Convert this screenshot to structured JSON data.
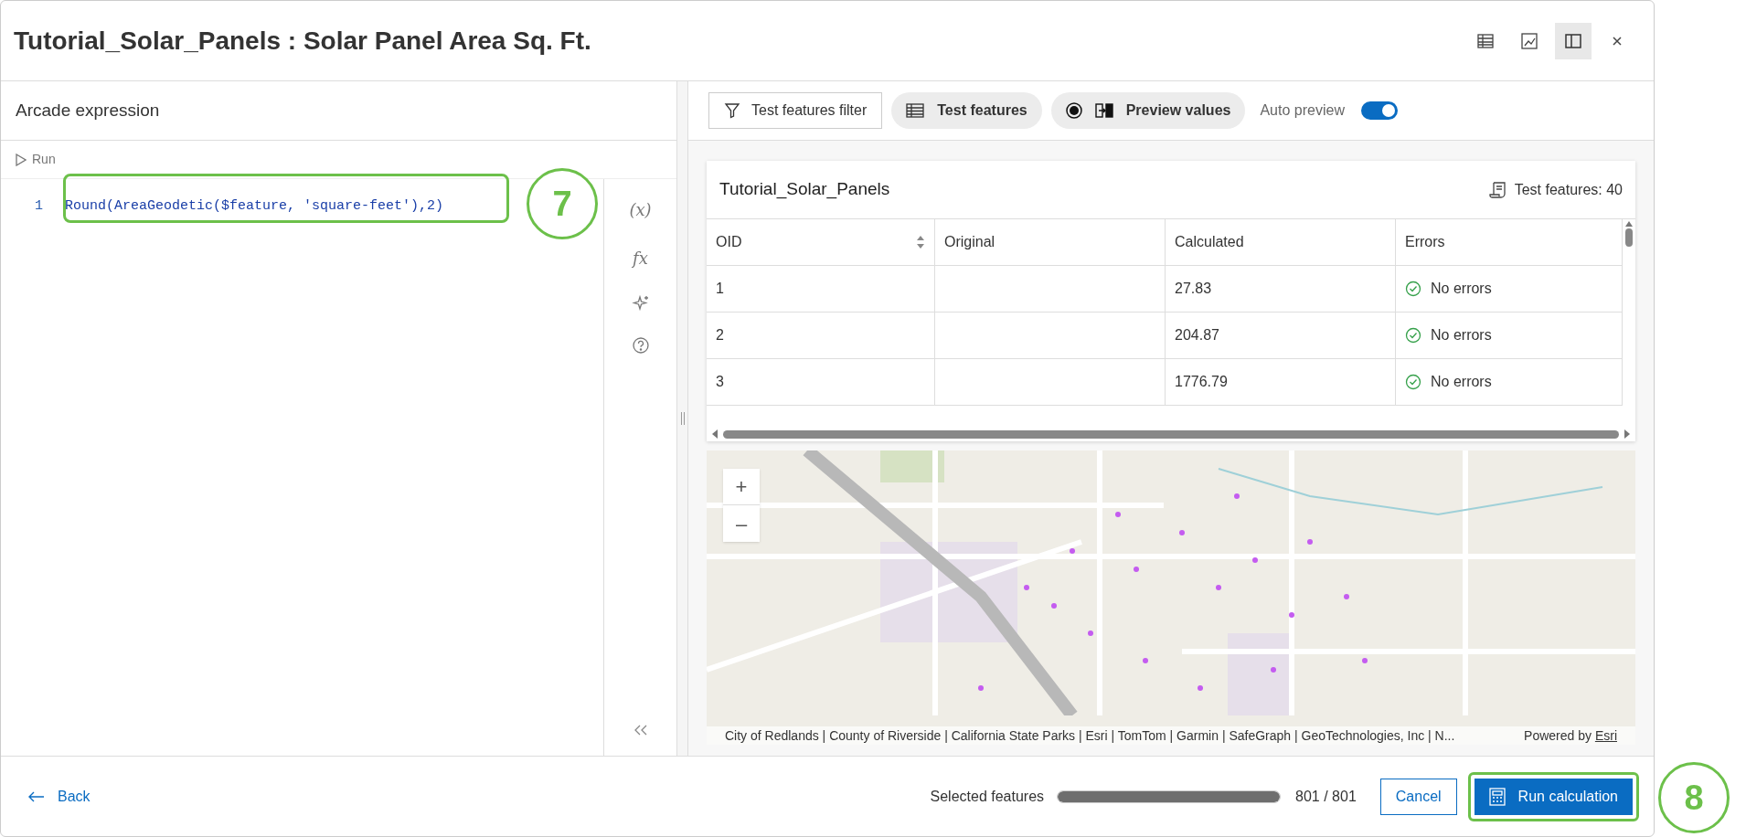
{
  "window": {
    "title": "Tutorial_Solar_Panels : Solar Panel Area Sq. Ft."
  },
  "header_buttons": [
    {
      "kind": "table",
      "selected": false
    },
    {
      "kind": "chart",
      "selected": false
    },
    {
      "kind": "panel",
      "selected": true
    },
    {
      "kind": "close",
      "selected": false
    }
  ],
  "editor": {
    "title": "Arcade expression",
    "run_label": "Run",
    "lines": [
      {
        "number": "1",
        "code": "Round(AreaGeodetic($feature, 'square-feet'),2)"
      }
    ],
    "side_tools": [
      {
        "label": "(x)",
        "kind": "text"
      },
      {
        "label": "fx",
        "kind": "text"
      },
      {
        "kind": "sparkle"
      },
      {
        "kind": "help"
      }
    ]
  },
  "toolbar": {
    "filter_button": "Test features filter",
    "test_features_button": "Test features",
    "preview_button": "Preview values",
    "auto_preview": {
      "label": "Auto preview",
      "on": true
    }
  },
  "table": {
    "title": "Tutorial_Solar_Panels",
    "count": "Test features: 40",
    "columns": [
      "OID",
      "Original",
      "Calculated",
      "Errors"
    ],
    "rows": [
      {
        "oid": "1",
        "original": "",
        "calculated": "27.83",
        "errors": "No errors"
      },
      {
        "oid": "2",
        "original": "",
        "calculated": "204.87",
        "errors": "No errors"
      },
      {
        "oid": "3",
        "original": "",
        "calculated": "1776.79",
        "errors": "No errors"
      }
    ]
  },
  "map": {
    "zoom_in": "+",
    "zoom_out": "–",
    "attribution": "City of Redlands | County of Riverside | California State Parks | Esri | TomTom | Garmin | SafeGraph | GeoTechnologies, Inc | N...",
    "powered_by": "Powered by",
    "powered_link": "Esri"
  },
  "footer": {
    "back": "Back",
    "selected_label": "Selected features",
    "selected": {
      "level": 1
    },
    "selected_count": "801 / 801",
    "cancel": "Cancel",
    "run": "Run calculation"
  },
  "annotations": [
    "7",
    "8"
  ]
}
